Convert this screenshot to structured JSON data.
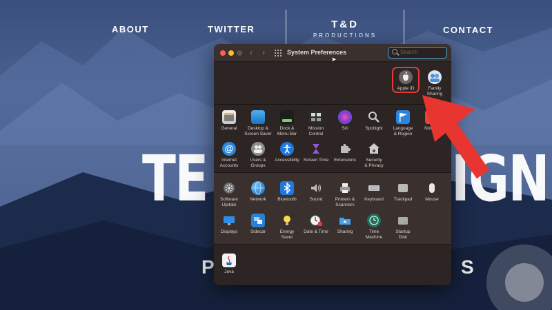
{
  "site": {
    "nav": [
      "ABOUT",
      "TWITTER",
      "CONTACT"
    ],
    "logo_main": "T&D",
    "logo_sub": "PRODUCTIONS",
    "hero_left": "TE",
    "hero_right": "IGN",
    "hero_sub_left": "P",
    "hero_sub_right": "S"
  },
  "window": {
    "title": "System Preferences",
    "search_placeholder": "Search",
    "account": [
      {
        "label": "Apple ID",
        "icon": "apple-logo-icon",
        "highlighted": true
      },
      {
        "label": "Family\nSharing",
        "icon": "family-sharing-icon"
      }
    ],
    "row1": [
      {
        "label": "General",
        "icon": "general-icon"
      },
      {
        "label": "Desktop &\nScreen Saver",
        "icon": "desktop-icon"
      },
      {
        "label": "Dock &\nMenu Bar",
        "icon": "dock-icon"
      },
      {
        "label": "Mission\nControl",
        "icon": "mission-control-icon"
      },
      {
        "label": "Siri",
        "icon": "siri-icon"
      },
      {
        "label": "Spotlight",
        "icon": "spotlight-icon"
      },
      {
        "label": "Language\n& Region",
        "icon": "flag-icon"
      },
      {
        "label": "Notifica",
        "icon": "bell-icon"
      }
    ],
    "row2": [
      {
        "label": "Internet\nAccounts",
        "icon": "at-icon"
      },
      {
        "label": "Users &\nGroups",
        "icon": "users-icon"
      },
      {
        "label": "Accessibility",
        "icon": "accessibility-icon"
      },
      {
        "label": "Screen Time",
        "icon": "hourglass-icon"
      },
      {
        "label": "Extensions",
        "icon": "puzzle-icon"
      },
      {
        "label": "Security\n& Privacy",
        "icon": "house-lock-icon"
      }
    ],
    "row3": [
      {
        "label": "Software\nUpdate",
        "icon": "gear-icon"
      },
      {
        "label": "Network",
        "icon": "globe-icon"
      },
      {
        "label": "Bluetooth",
        "icon": "bluetooth-icon"
      },
      {
        "label": "Sound",
        "icon": "speaker-icon"
      },
      {
        "label": "Printers &\nScanners",
        "icon": "printer-icon"
      },
      {
        "label": "Keyboard",
        "icon": "keyboard-icon"
      },
      {
        "label": "Trackpad",
        "icon": "trackpad-icon"
      },
      {
        "label": "Mouse",
        "icon": "mouse-icon"
      }
    ],
    "row4": [
      {
        "label": "Displays",
        "icon": "display-icon"
      },
      {
        "label": "Sidecar",
        "icon": "sidecar-icon"
      },
      {
        "label": "Energy\nSaver",
        "icon": "lightbulb-icon"
      },
      {
        "label": "Date & Time",
        "icon": "clock-icon"
      },
      {
        "label": "Sharing",
        "icon": "folder-share-icon"
      },
      {
        "label": "Time\nMachine",
        "icon": "time-machine-icon"
      },
      {
        "label": "Startup\nDisk",
        "icon": "disk-icon"
      }
    ],
    "other": [
      {
        "label": "Java",
        "icon": "java-icon"
      }
    ]
  },
  "colors": {
    "highlight": "#e23b3b",
    "arrow": "#e8352f",
    "window_bg": "#2d2523",
    "search_focus": "#4aa3d6"
  }
}
